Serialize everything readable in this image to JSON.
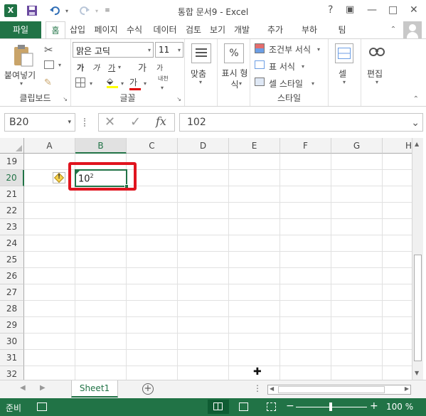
{
  "window": {
    "title": "통합 문서9 - Excel",
    "help": "?",
    "restore_ribbon": "▣",
    "minimize": "—",
    "maximize": "□",
    "close": "✕"
  },
  "qat": {
    "save_icon": "save-icon",
    "undo_icon": "undo-icon",
    "redo_icon": "redo-icon"
  },
  "tabs": {
    "file": "파일",
    "items": [
      "홈",
      "삽입",
      "페이지",
      "수식",
      "데이터",
      "검토",
      "보기",
      "개발",
      "추가",
      "부하",
      "팀"
    ]
  },
  "ribbon": {
    "clipboard": {
      "paste": "붙여넣기",
      "label": "클립보드"
    },
    "font": {
      "name": "맑은 고딕",
      "size": "11",
      "bold": "가",
      "italic": "가",
      "underline": "가",
      "grow": "가",
      "shrink": "가",
      "phonetic": "내천",
      "color": "가",
      "label": "글꼴"
    },
    "alignment": {
      "label": "맞춤"
    },
    "number": {
      "percent": "%",
      "label": "표시 형식"
    },
    "styles": {
      "conditional": "조건부 서식",
      "table": "표 서식",
      "cell": "셀 스타일",
      "label": "스타일"
    },
    "cells": {
      "label": "셀"
    },
    "editing": {
      "label": "편집"
    }
  },
  "formula_bar": {
    "name_box": "B20",
    "fx": "fx",
    "value": "102"
  },
  "grid": {
    "columns": [
      "A",
      "B",
      "C",
      "D",
      "E",
      "F",
      "G",
      "H"
    ],
    "rows": [
      "19",
      "20",
      "21",
      "22",
      "23",
      "24",
      "25",
      "26",
      "27",
      "28",
      "29",
      "30",
      "31",
      "32"
    ],
    "selected_cell": "B20",
    "cell_b20_base": "10",
    "cell_b20_sup": "2",
    "warning_icon": "!"
  },
  "sheets": {
    "active": "Sheet1",
    "add": "+"
  },
  "status": {
    "ready": "준비",
    "zoom": "100 %"
  }
}
